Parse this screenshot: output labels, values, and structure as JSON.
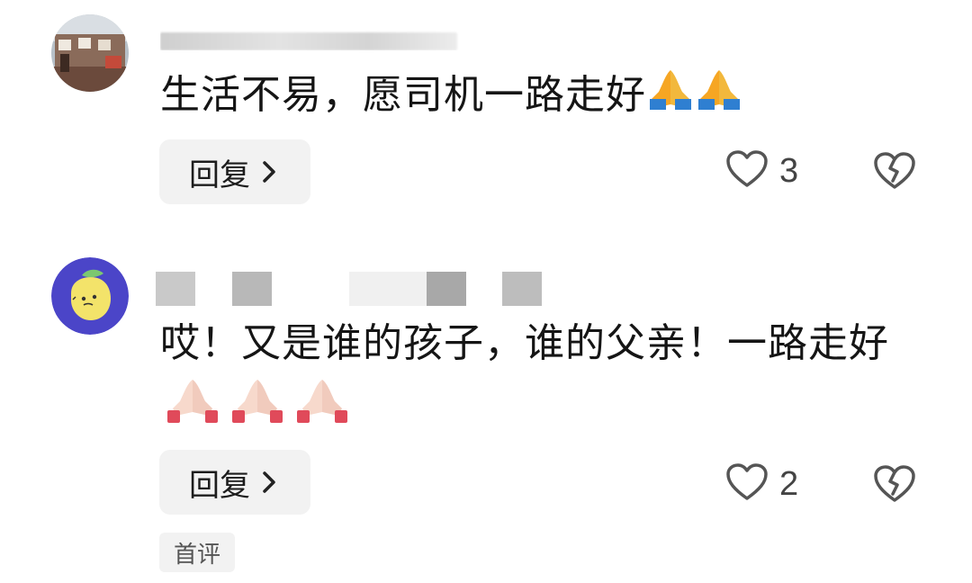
{
  "comments": [
    {
      "text": "生活不易，愿司机一路走好",
      "emoji": [
        "folded-hands-icon",
        "folded-hands-icon"
      ],
      "reply_label": "回复",
      "like_count": "3"
    },
    {
      "text": "哎！又是谁的孩子，谁的父亲！一路走好",
      "emoji": [
        "folded-hands-nails-icon",
        "folded-hands-nails-icon",
        "folded-hands-nails-icon"
      ],
      "reply_label": "回复",
      "like_count": "2",
      "badge": "首评"
    }
  ],
  "colors": {
    "reply_bg": "#f2f2f2",
    "text": "#151515",
    "avatar2_bg": "#4b45c8",
    "lemon": "#f3e36a"
  }
}
